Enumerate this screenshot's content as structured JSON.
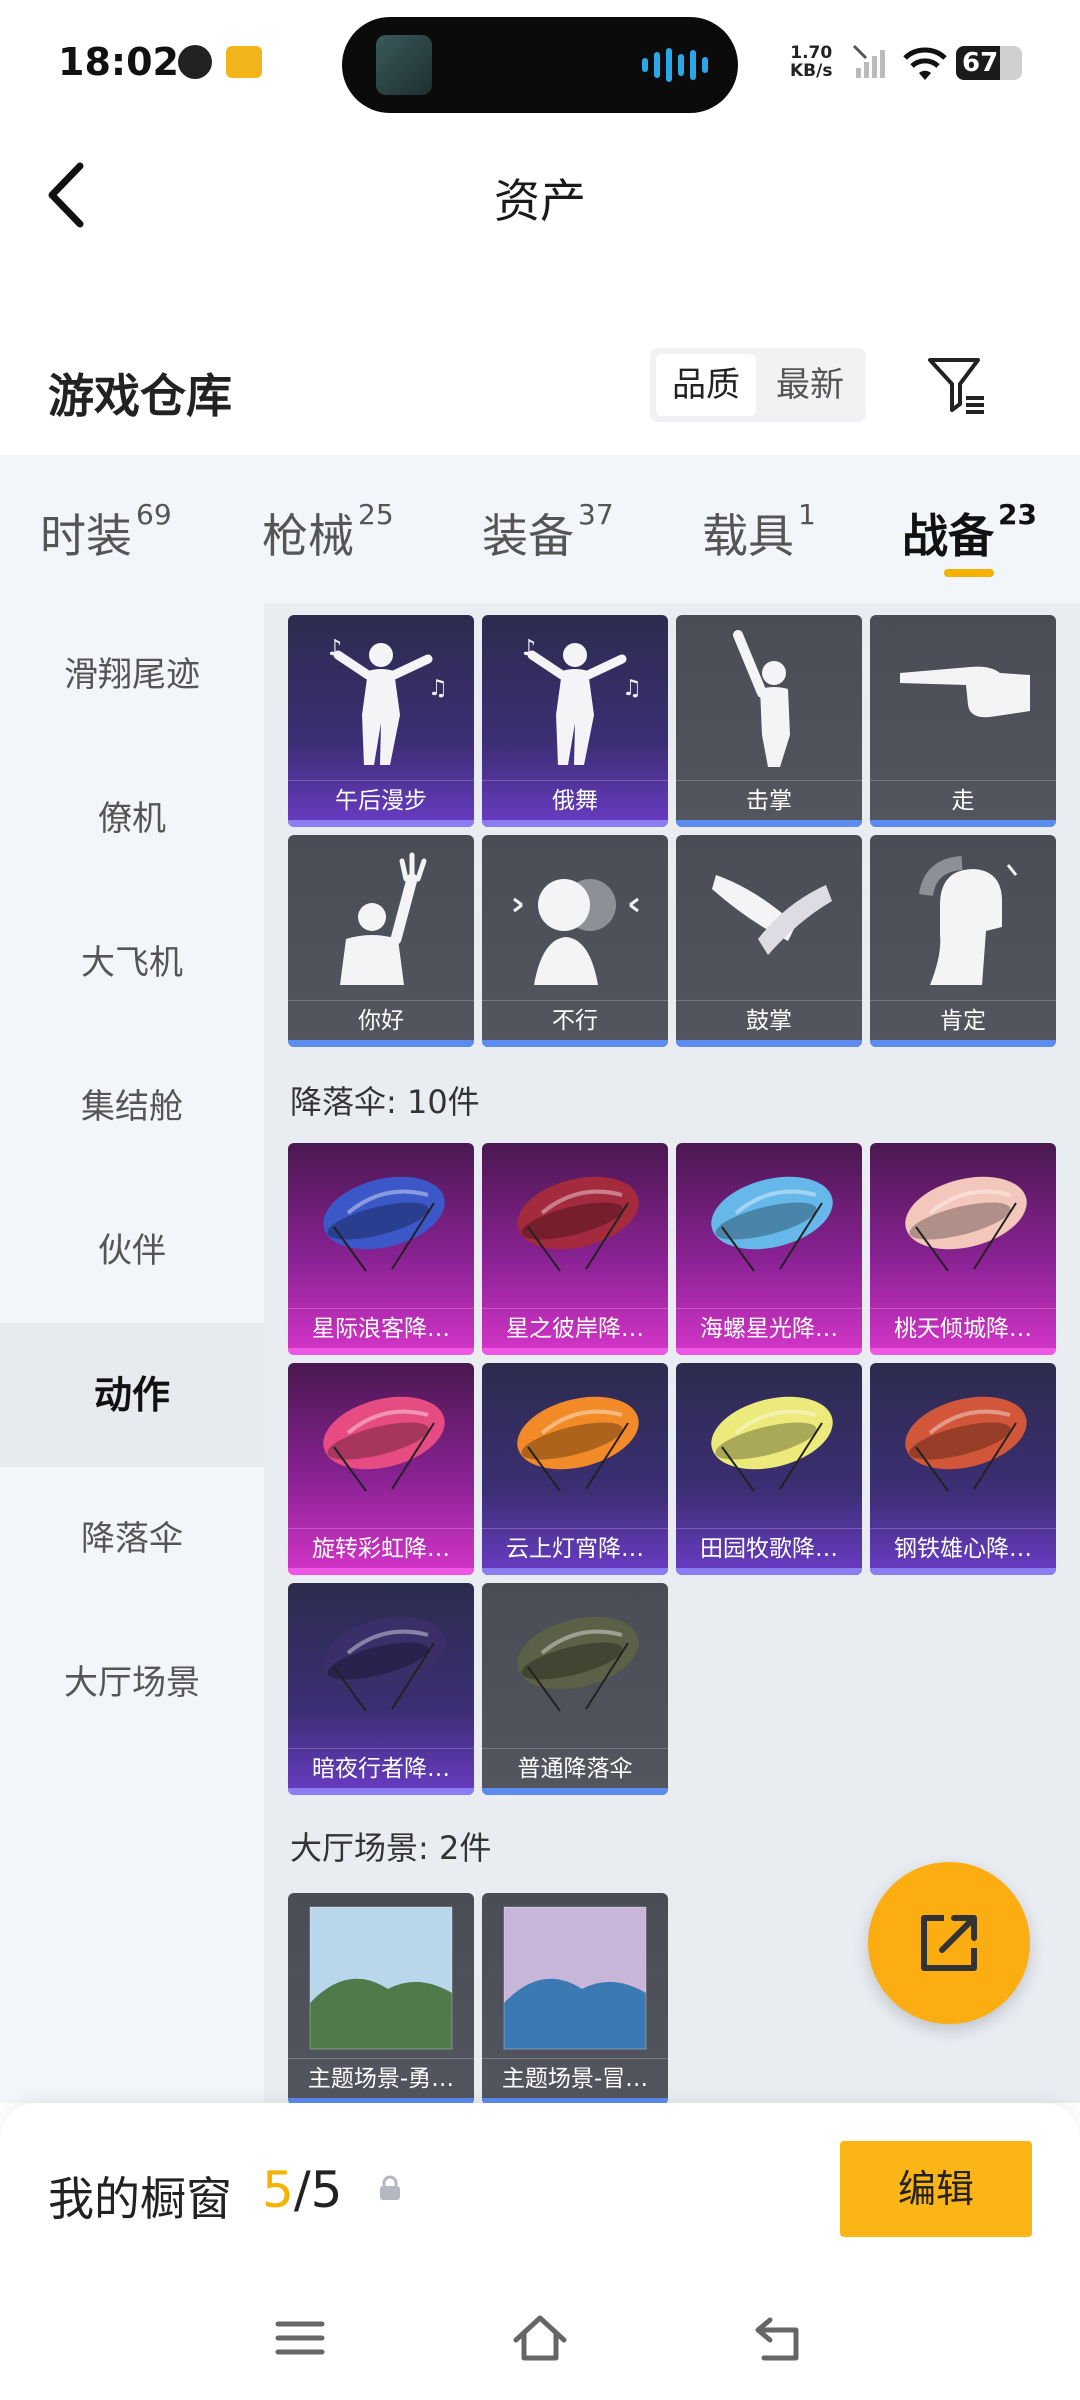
{
  "status_bar": {
    "time": "18:02",
    "net_speed_value": "1.70",
    "net_speed_unit": "KB/s",
    "battery": "67"
  },
  "nav": {
    "title": "资产"
  },
  "header": {
    "heading": "游戏仓库",
    "sort_options": [
      "品质",
      "最新"
    ],
    "sort_selected": "品质"
  },
  "tabs": [
    {
      "label": "时装",
      "count": "69"
    },
    {
      "label": "枪械",
      "count": "25"
    },
    {
      "label": "装备",
      "count": "37"
    },
    {
      "label": "载具",
      "count": "1"
    },
    {
      "label": "战备",
      "count": "23"
    }
  ],
  "active_tab": "战备",
  "side_categories": [
    "滑翔尾迹",
    "僚机",
    "大飞机",
    "集结舱",
    "伙伴",
    "动作",
    "降落伞",
    "大厅场景"
  ],
  "active_side_category": "动作",
  "emotes": [
    {
      "name": "午后漫步",
      "tier": "blue",
      "icon": "dance-figure-icon"
    },
    {
      "name": "俄舞",
      "tier": "blue",
      "icon": "dance-figure-icon"
    },
    {
      "name": "击掌",
      "tier": "gray",
      "icon": "raise-hand-figure-icon"
    },
    {
      "name": "走",
      "tier": "gray",
      "icon": "pointing-hand-icon"
    },
    {
      "name": "你好",
      "tier": "gray",
      "icon": "wave-figure-icon"
    },
    {
      "name": "不行",
      "tier": "gray",
      "icon": "shake-head-icon"
    },
    {
      "name": "鼓掌",
      "tier": "gray",
      "icon": "clapping-hands-icon"
    },
    {
      "name": "肯定",
      "tier": "gray",
      "icon": "nod-head-icon"
    }
  ],
  "parachute_section": {
    "title": "降落伞: 10件"
  },
  "parachutes": [
    {
      "name": "星际浪客降…",
      "tier": "pink",
      "color": "#3b57c8"
    },
    {
      "name": "星之彼岸降…",
      "tier": "pink",
      "color": "#a42a3e"
    },
    {
      "name": "海螺星光降…",
      "tier": "pink",
      "color": "#67b8ea"
    },
    {
      "name": "桃天倾城降…",
      "tier": "pink",
      "color": "#f3c7bb"
    },
    {
      "name": "旋转彩虹降…",
      "tier": "pink",
      "color": "#e64b82"
    },
    {
      "name": "云上灯宵降…",
      "tier": "blue",
      "color": "#f28a28"
    },
    {
      "name": "田园牧歌降…",
      "tier": "blue",
      "color": "#ecea7a"
    },
    {
      "name": "钢铁雄心降…",
      "tier": "blue",
      "color": "#d1563a"
    },
    {
      "name": "暗夜行者降…",
      "tier": "blue",
      "color": "#3b2f6a"
    },
    {
      "name": "普通降落伞",
      "tier": "gray",
      "color": "#5a6146"
    }
  ],
  "lobby_section": {
    "title": "大厅场景: 2件"
  },
  "lobby_scenes": [
    {
      "name": "主题场景-勇…",
      "tier": "gray",
      "sky": "#b9d6ea",
      "ground": "#4f7a4a"
    },
    {
      "name": "主题场景-冒…",
      "tier": "gray",
      "sky": "#c8b6d9",
      "ground": "#3b79b4"
    }
  ],
  "showcase": {
    "label": "我的橱窗",
    "current": "5",
    "total": "/5",
    "edit_label": "编辑"
  },
  "colors": {
    "accent": "#fbb516",
    "blue_tier": "#8c7df2",
    "gray_tier": "#5c8cf0",
    "pink_tier": "#ee56e6"
  }
}
